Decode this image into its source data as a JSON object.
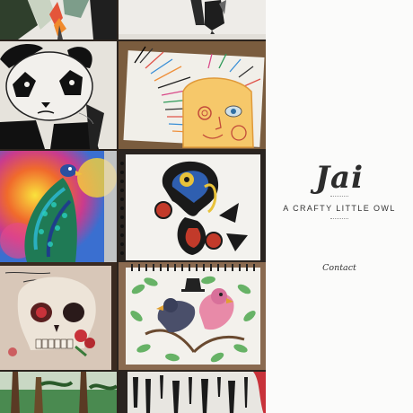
{
  "site": {
    "title": "Jai",
    "tagline": "A CRAFTY LITTLE OWL"
  },
  "nav": {
    "contact_label": "Contact"
  },
  "gallery": {
    "tiles": [
      "artwork-flower-crop",
      "artwork-black-ink-crop",
      "artwork-panda",
      "artwork-sun-face",
      "artwork-peacock",
      "artwork-paisley",
      "artwork-skull",
      "artwork-birds",
      "artwork-forest",
      "artwork-ink-drips"
    ]
  },
  "colors": {
    "sidebar_bg": "#fbfbfa",
    "title_color": "#2d2d2d",
    "gallery_bg": "#2b231d"
  }
}
